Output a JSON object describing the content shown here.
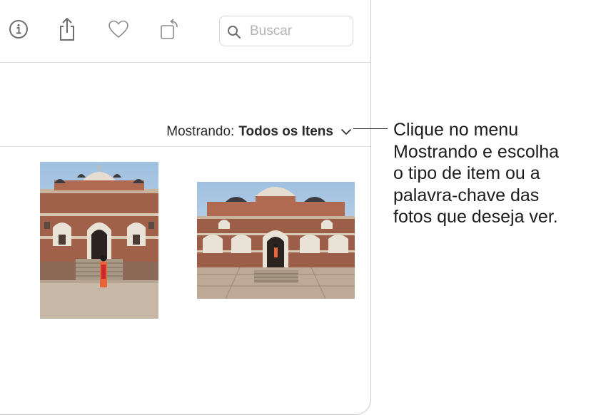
{
  "toolbar": {
    "icons": [
      "info-icon",
      "share-icon",
      "heart-icon",
      "rotate-icon"
    ],
    "search_placeholder": "Buscar"
  },
  "filter": {
    "prefix": "Mostrando:",
    "value": "Todos os Itens"
  },
  "photos": [
    {
      "orientation": "portrait",
      "subject": "Humayun's Tomb with woman in orange"
    },
    {
      "orientation": "landscape",
      "subject": "Humayun's Tomb wide view"
    }
  ],
  "callout": {
    "lines": [
      "Clique no menu",
      "Mostrando e escolha",
      "o tipo de item ou a",
      "palavra-chave das",
      "fotos que deseja ver."
    ]
  },
  "colors": {
    "icon": "#6e6e6e",
    "border": "#c9c9c9",
    "text": "#1d1d1d"
  }
}
